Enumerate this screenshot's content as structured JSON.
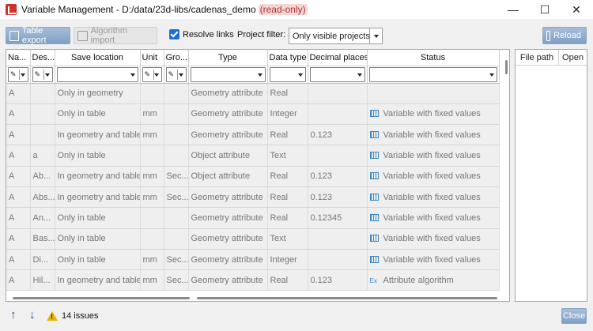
{
  "window": {
    "title": "Variable Management - D:/data/23d-libs/cadenas_demo",
    "readonly": "(read-only)",
    "minimize": "—",
    "maximize": "☐",
    "close": "✕"
  },
  "toolbar": {
    "table_export": "Table export",
    "algorithm_import": "Algorithm import",
    "resolve_links": "Resolve links",
    "resolve_links_checked": true,
    "project_filter_label": "Project filter:",
    "project_filter_value": "Only visible projects",
    "reload": "Reload"
  },
  "table": {
    "columns": [
      "Na...",
      "Des...",
      "Save location",
      "Unit",
      "Gro...",
      "Type",
      "Data type",
      "Decimal places",
      "Status"
    ],
    "rows": [
      [
        "A",
        "",
        "Only in geometry",
        "",
        "",
        "Geometry attribute",
        "Real",
        "",
        ""
      ],
      [
        "A",
        "",
        "Only in table",
        "mm",
        "",
        "Geometry attribute",
        "Integer",
        "",
        "Variable with fixed values"
      ],
      [
        "A",
        "",
        "In geometry and table",
        "mm",
        "",
        "Geometry attribute",
        "Real",
        "0.123",
        "Variable with fixed values"
      ],
      [
        "A",
        "a",
        "Only in table",
        "",
        "",
        "Object attribute",
        "Text",
        "",
        "Variable with fixed values"
      ],
      [
        "A",
        "Ab...",
        "In geometry and table",
        "mm",
        "Sec...",
        "Object attribute",
        "Real",
        "0.123",
        "Variable with fixed values"
      ],
      [
        "A",
        "Abs...",
        "In geometry and table",
        "mm",
        "Sec...",
        "Geometry attribute",
        "Real",
        "0.123",
        "Variable with fixed values"
      ],
      [
        "A",
        "An...",
        "Only in table",
        "",
        "",
        "Geometry attribute",
        "Real",
        "0.12345",
        "Variable with fixed values"
      ],
      [
        "A",
        "Bas...",
        "Only in table",
        "",
        "",
        "Geometry attribute",
        "Text",
        "",
        "Variable with fixed values"
      ],
      [
        "A",
        "Di...",
        "Only in table",
        "mm",
        "Sec...",
        "Geometry attribute",
        "Integer",
        "",
        "Variable with fixed values"
      ],
      [
        "A",
        "Hil...",
        "In geometry and table",
        "mm",
        "Sec...",
        "Geometry attribute",
        "Real",
        "0.123",
        "Attribute algorithm"
      ]
    ]
  },
  "side_panel": {
    "columns": [
      "File path",
      "Open"
    ]
  },
  "footer": {
    "up": "↑",
    "down": "↓",
    "issues": "14 issues",
    "close": "Close"
  }
}
